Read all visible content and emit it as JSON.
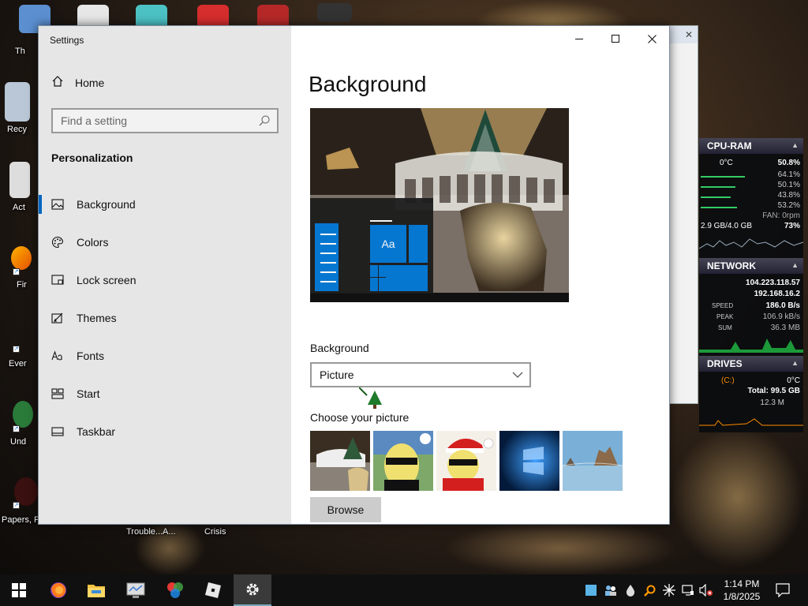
{
  "desktop": {
    "icons": [
      {
        "label": "Th",
        "icon": "this-pc-icon"
      },
      {
        "label": "Recy",
        "icon": "recycle-bin-icon"
      },
      {
        "label": "Act",
        "icon": "action-icon"
      },
      {
        "label": "Fir",
        "icon": "firefox-icon"
      },
      {
        "label": "Ever",
        "icon": "evernote-icon"
      },
      {
        "label": "Und",
        "icon": "undertale-icon"
      },
      {
        "label": "Papers, P",
        "icon": "papers-please-icon"
      },
      {
        "label": "Trouble...A...",
        "icon": "trouble-icon"
      },
      {
        "label": "Crisis",
        "icon": "crisis-icon"
      }
    ]
  },
  "settings": {
    "window_title": "Settings",
    "home_label": "Home",
    "search_placeholder": "Find a setting",
    "section_title": "Personalization",
    "nav": [
      {
        "label": "Background",
        "icon": "picture-icon",
        "active": true
      },
      {
        "label": "Colors",
        "icon": "palette-icon",
        "active": false
      },
      {
        "label": "Lock screen",
        "icon": "lock-screen-icon",
        "active": false
      },
      {
        "label": "Themes",
        "icon": "themes-icon",
        "active": false
      },
      {
        "label": "Fonts",
        "icon": "fonts-icon",
        "active": false
      },
      {
        "label": "Start",
        "icon": "start-icon",
        "active": false
      },
      {
        "label": "Taskbar",
        "icon": "taskbar-icon",
        "active": false
      }
    ],
    "page_title": "Background",
    "preview_tile_text": "Aa",
    "background_label": "Background",
    "background_value": "Picture",
    "choose_label": "Choose your picture",
    "browse_label": "Browse"
  },
  "gadget": {
    "cpu_ram": {
      "title": "CPU-RAM",
      "temp": "0°C",
      "total": "50.8%",
      "cores": [
        "64.1%",
        "50.1%",
        "43.8%",
        "53.2%"
      ],
      "fan": "FAN: 0rpm",
      "ram": "2.9 GB/4.0 GB",
      "ram_pct": "73%"
    },
    "network": {
      "title": "NETWORK",
      "ip_external": "104.223.118.57",
      "ip_local": "192.168.16.2",
      "speed_label": "SPEED",
      "speed": "186.0 B/s",
      "peak_label": "PEAK",
      "peak": "106.9 kB/s",
      "sum_label": "SUM",
      "sum": "36.3 MB"
    },
    "drives": {
      "title": "DRIVES",
      "drive": "(C:)",
      "temp": "0°C",
      "total": "Total: 99.5 GB",
      "used": "12.3 M"
    }
  },
  "taskbar": {
    "apps": [
      "start-icon",
      "firefox-icon",
      "file-explorer-icon",
      "system-info-icon",
      "colorful-app-icon",
      "roblox-icon",
      "settings-icon"
    ],
    "clock_time": "1:14 PM",
    "clock_date": "1/8/2025"
  }
}
